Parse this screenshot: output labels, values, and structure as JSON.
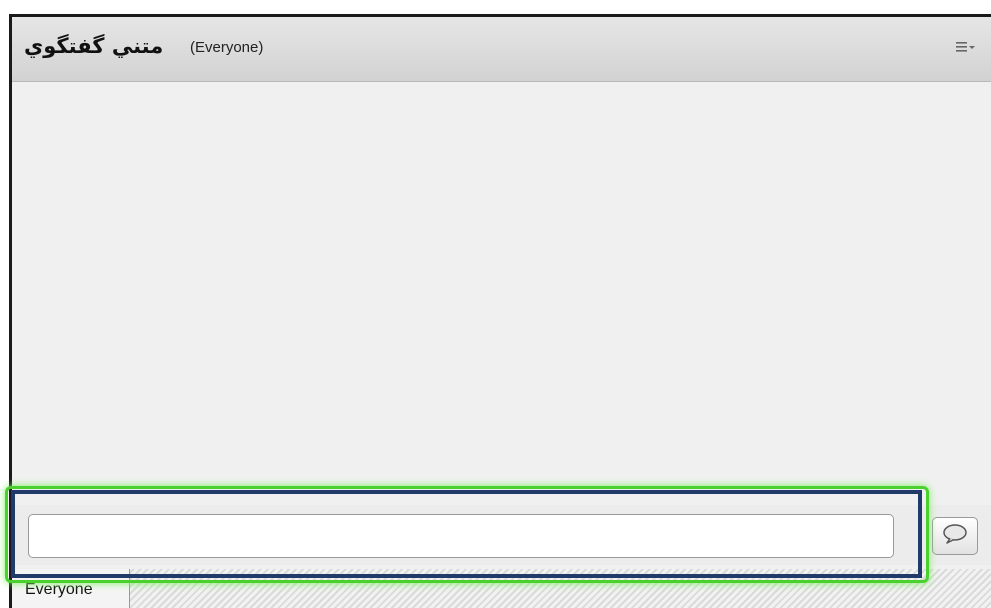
{
  "header": {
    "title": "متني گفتگوي",
    "scope": "(Everyone)",
    "menu_icon": "menu-list-icon"
  },
  "composer": {
    "message_value": "",
    "placeholder": "",
    "send_icon": "speech-bubble-icon"
  },
  "tabs": [
    {
      "label": "Everyone",
      "selected": true
    }
  ],
  "colors": {
    "highlight_outer": "#4ad12f",
    "highlight_inner": "#203a6a",
    "titlebar": "#dcdcdc",
    "body": "#f0f0f0"
  }
}
